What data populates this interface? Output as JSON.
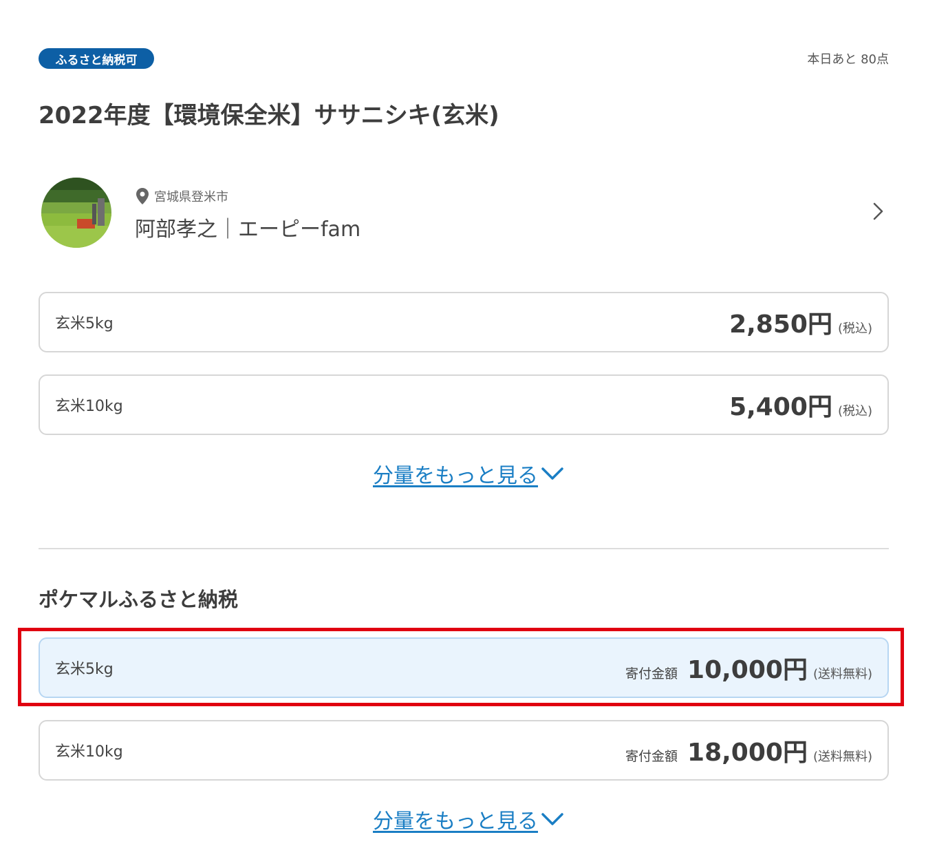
{
  "header": {
    "badge": "ふるさと納税可",
    "stock": "本日あと 80点",
    "title": "2022年度【環境保全米】ササニシキ(玄米)"
  },
  "producer": {
    "location": "宮城県登米市",
    "name": "阿部孝之｜エーピーfam"
  },
  "regular_options": [
    {
      "label": "玄米5kg",
      "price": "2,850円",
      "note": "(税込)"
    },
    {
      "label": "玄米10kg",
      "price": "5,400円",
      "note": "(税込)"
    }
  ],
  "more_link_1": "分量をもっと見る",
  "furusato": {
    "title": "ポケマルふるさと納税",
    "options": [
      {
        "label": "玄米5kg",
        "prefix": "寄付金額",
        "price": "10,000円",
        "note": "(送料無料)",
        "selected": true
      },
      {
        "label": "玄米10kg",
        "prefix": "寄付金額",
        "price": "18,000円",
        "note": "(送料無料)",
        "selected": false
      }
    ],
    "more_link": "分量をもっと見る"
  },
  "colors": {
    "badge_bg": "#0d5fa5",
    "link": "#1a7ec4",
    "selected_bg": "#eaf4fd",
    "highlight": "#e00010"
  }
}
